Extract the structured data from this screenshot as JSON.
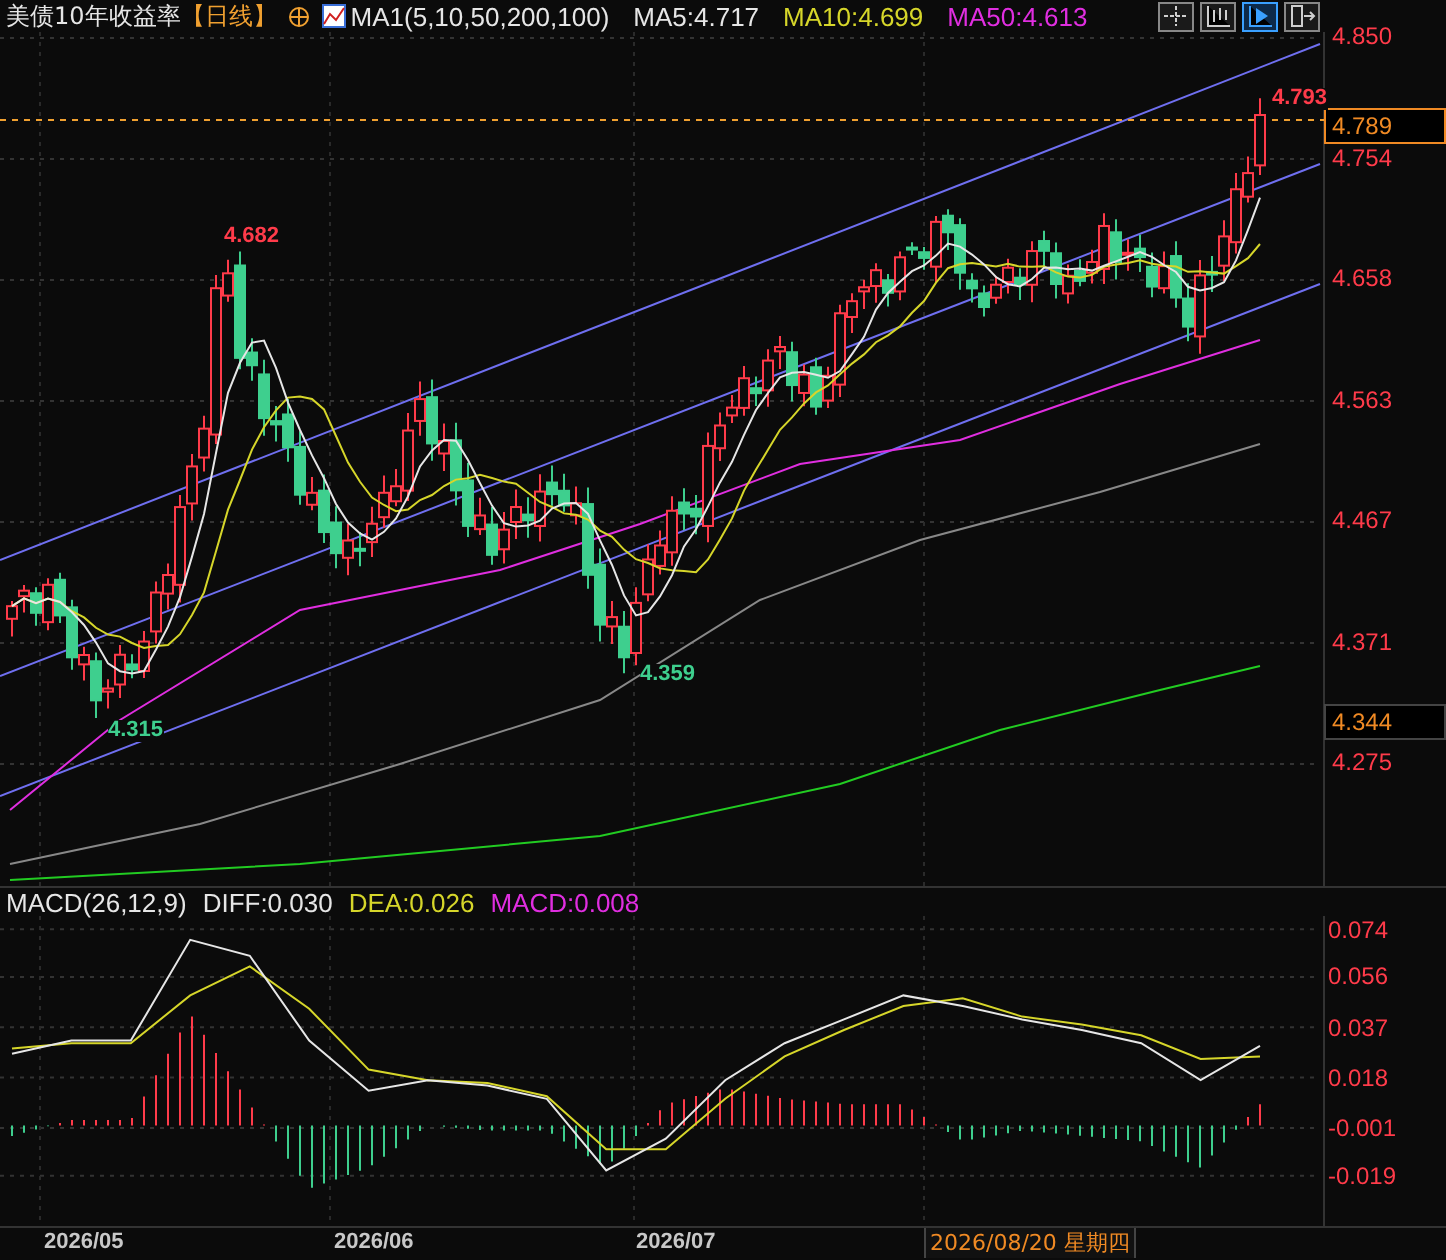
{
  "header": {
    "title": "美债10年收益率",
    "period": "【日线】",
    "indicator": "MA1(5,10,50,200,100)",
    "ma_values": [
      {
        "text": "MA5:4.717",
        "color": "#e6e6e6"
      },
      {
        "text": "MA10:4.699",
        "color": "#d6d62a"
      },
      {
        "text": "MA50:4.613",
        "color": "#e02ee0"
      }
    ],
    "toolbar": [
      {
        "selected": false
      },
      {
        "selected": false
      },
      {
        "selected": true
      },
      {
        "selected": false
      }
    ]
  },
  "price_axis": [
    "4.850",
    "4.754",
    "4.658",
    "4.563",
    "4.467",
    "4.371",
    "4.275"
  ],
  "price_tags": [
    {
      "text": "4.789",
      "kind": "last"
    },
    {
      "text": "4.344",
      "kind": "ref"
    }
  ],
  "markers": [
    {
      "text": "4.793",
      "kind": "high"
    },
    {
      "text": "4.682",
      "kind": "high"
    },
    {
      "text": "4.315",
      "kind": "low"
    },
    {
      "text": "4.359",
      "kind": "low"
    }
  ],
  "macd": {
    "title": "MACD(26,12,9)",
    "values": [
      {
        "text": "DIFF:0.030",
        "color": "#e6e6e6"
      },
      {
        "text": "DEA:0.026",
        "color": "#d6d62a"
      },
      {
        "text": "MACD:0.008",
        "color": "#e02ee0"
      }
    ],
    "chart_data": {
      "type": "line",
      "ylim": [
        -0.038,
        0.079
      ],
      "grid": true,
      "yticks": [
        {
          "value": 0.074,
          "label": "0.074"
        },
        {
          "value": 0.056,
          "label": "0.056"
        },
        {
          "value": 0.037,
          "label": "0.037"
        },
        {
          "value": 0.018,
          "label": "0.018"
        },
        {
          "value": -0.001,
          "label": "-0.001"
        },
        {
          "value": -0.019,
          "label": "-0.019"
        }
      ],
      "series": [
        {
          "color": "#e6e6e6",
          "values": [
            0.027,
            0.032,
            0.032,
            0.07,
            0.064,
            0.032,
            0.013,
            0.017,
            0.015,
            0.01,
            -0.017,
            -0.005,
            0.017,
            0.031,
            0.04,
            0.049,
            0.045,
            0.04,
            0.036,
            0.031,
            0.017,
            0.03
          ]
        },
        {
          "color": "#d6d62a",
          "values": [
            0.029,
            0.031,
            0.031,
            0.049,
            0.06,
            0.044,
            0.021,
            0.017,
            0.016,
            0.011,
            -0.009,
            -0.009,
            0.01,
            0.026,
            0.036,
            0.045,
            0.048,
            0.041,
            0.038,
            0.034,
            0.025,
            0.026
          ]
        }
      ]
    }
  },
  "date_axis": [
    "2026/05",
    "2026/06",
    "2026/07"
  ],
  "cursor_date": "2026/08/20 星期四"
}
